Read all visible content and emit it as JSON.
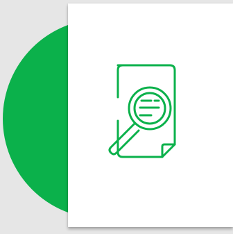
{
  "scene": {
    "background_color": "#e6e6e6",
    "accent_color": "#0bb14b",
    "card_color": "#ffffff",
    "icon": {
      "name": "document-search-icon",
      "stroke_color": "#0bb14b"
    }
  }
}
